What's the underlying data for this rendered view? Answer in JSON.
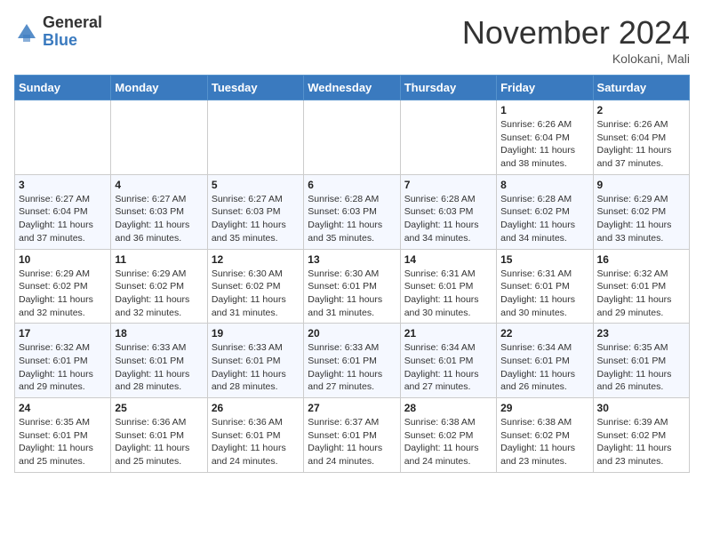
{
  "header": {
    "logo_general": "General",
    "logo_blue": "Blue",
    "month_title": "November 2024",
    "location": "Kolokani, Mali"
  },
  "weekdays": [
    "Sunday",
    "Monday",
    "Tuesday",
    "Wednesday",
    "Thursday",
    "Friday",
    "Saturday"
  ],
  "weeks": [
    [
      {
        "day": "",
        "text": ""
      },
      {
        "day": "",
        "text": ""
      },
      {
        "day": "",
        "text": ""
      },
      {
        "day": "",
        "text": ""
      },
      {
        "day": "",
        "text": ""
      },
      {
        "day": "1",
        "text": "Sunrise: 6:26 AM\nSunset: 6:04 PM\nDaylight: 11 hours and 38 minutes."
      },
      {
        "day": "2",
        "text": "Sunrise: 6:26 AM\nSunset: 6:04 PM\nDaylight: 11 hours and 37 minutes."
      }
    ],
    [
      {
        "day": "3",
        "text": "Sunrise: 6:27 AM\nSunset: 6:04 PM\nDaylight: 11 hours and 37 minutes."
      },
      {
        "day": "4",
        "text": "Sunrise: 6:27 AM\nSunset: 6:03 PM\nDaylight: 11 hours and 36 minutes."
      },
      {
        "day": "5",
        "text": "Sunrise: 6:27 AM\nSunset: 6:03 PM\nDaylight: 11 hours and 35 minutes."
      },
      {
        "day": "6",
        "text": "Sunrise: 6:28 AM\nSunset: 6:03 PM\nDaylight: 11 hours and 35 minutes."
      },
      {
        "day": "7",
        "text": "Sunrise: 6:28 AM\nSunset: 6:03 PM\nDaylight: 11 hours and 34 minutes."
      },
      {
        "day": "8",
        "text": "Sunrise: 6:28 AM\nSunset: 6:02 PM\nDaylight: 11 hours and 34 minutes."
      },
      {
        "day": "9",
        "text": "Sunrise: 6:29 AM\nSunset: 6:02 PM\nDaylight: 11 hours and 33 minutes."
      }
    ],
    [
      {
        "day": "10",
        "text": "Sunrise: 6:29 AM\nSunset: 6:02 PM\nDaylight: 11 hours and 32 minutes."
      },
      {
        "day": "11",
        "text": "Sunrise: 6:29 AM\nSunset: 6:02 PM\nDaylight: 11 hours and 32 minutes."
      },
      {
        "day": "12",
        "text": "Sunrise: 6:30 AM\nSunset: 6:02 PM\nDaylight: 11 hours and 31 minutes."
      },
      {
        "day": "13",
        "text": "Sunrise: 6:30 AM\nSunset: 6:01 PM\nDaylight: 11 hours and 31 minutes."
      },
      {
        "day": "14",
        "text": "Sunrise: 6:31 AM\nSunset: 6:01 PM\nDaylight: 11 hours and 30 minutes."
      },
      {
        "day": "15",
        "text": "Sunrise: 6:31 AM\nSunset: 6:01 PM\nDaylight: 11 hours and 30 minutes."
      },
      {
        "day": "16",
        "text": "Sunrise: 6:32 AM\nSunset: 6:01 PM\nDaylight: 11 hours and 29 minutes."
      }
    ],
    [
      {
        "day": "17",
        "text": "Sunrise: 6:32 AM\nSunset: 6:01 PM\nDaylight: 11 hours and 29 minutes."
      },
      {
        "day": "18",
        "text": "Sunrise: 6:33 AM\nSunset: 6:01 PM\nDaylight: 11 hours and 28 minutes."
      },
      {
        "day": "19",
        "text": "Sunrise: 6:33 AM\nSunset: 6:01 PM\nDaylight: 11 hours and 28 minutes."
      },
      {
        "day": "20",
        "text": "Sunrise: 6:33 AM\nSunset: 6:01 PM\nDaylight: 11 hours and 27 minutes."
      },
      {
        "day": "21",
        "text": "Sunrise: 6:34 AM\nSunset: 6:01 PM\nDaylight: 11 hours and 27 minutes."
      },
      {
        "day": "22",
        "text": "Sunrise: 6:34 AM\nSunset: 6:01 PM\nDaylight: 11 hours and 26 minutes."
      },
      {
        "day": "23",
        "text": "Sunrise: 6:35 AM\nSunset: 6:01 PM\nDaylight: 11 hours and 26 minutes."
      }
    ],
    [
      {
        "day": "24",
        "text": "Sunrise: 6:35 AM\nSunset: 6:01 PM\nDaylight: 11 hours and 25 minutes."
      },
      {
        "day": "25",
        "text": "Sunrise: 6:36 AM\nSunset: 6:01 PM\nDaylight: 11 hours and 25 minutes."
      },
      {
        "day": "26",
        "text": "Sunrise: 6:36 AM\nSunset: 6:01 PM\nDaylight: 11 hours and 24 minutes."
      },
      {
        "day": "27",
        "text": "Sunrise: 6:37 AM\nSunset: 6:01 PM\nDaylight: 11 hours and 24 minutes."
      },
      {
        "day": "28",
        "text": "Sunrise: 6:38 AM\nSunset: 6:02 PM\nDaylight: 11 hours and 24 minutes."
      },
      {
        "day": "29",
        "text": "Sunrise: 6:38 AM\nSunset: 6:02 PM\nDaylight: 11 hours and 23 minutes."
      },
      {
        "day": "30",
        "text": "Sunrise: 6:39 AM\nSunset: 6:02 PM\nDaylight: 11 hours and 23 minutes."
      }
    ]
  ]
}
